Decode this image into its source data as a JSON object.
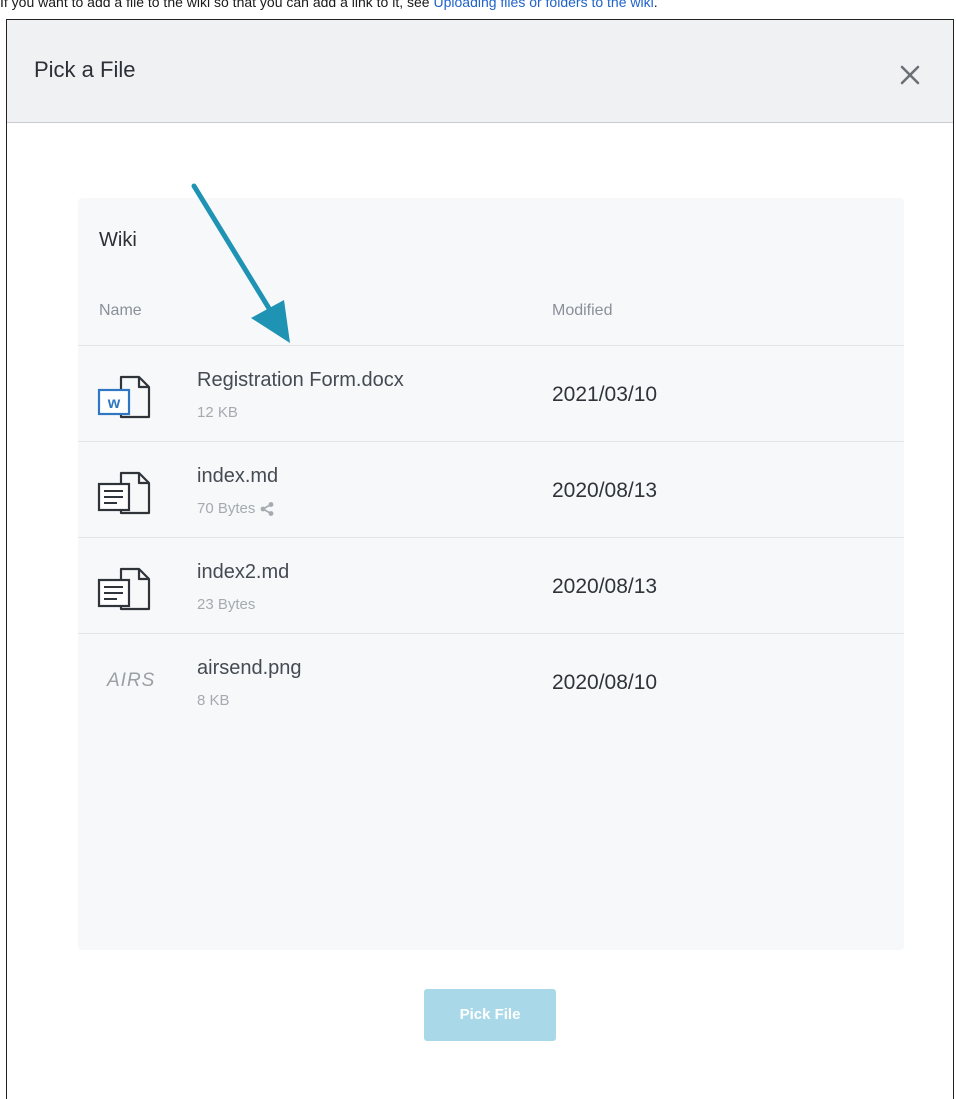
{
  "instruction": {
    "text_before": "If you want to add a file to the wiki so that you can add a link to it, see ",
    "link_text": "Uploading files or folders to the wiki",
    "text_after": "."
  },
  "modal": {
    "title": "Pick a File",
    "close_icon": "close-icon"
  },
  "panel": {
    "title": "Wiki",
    "columns": {
      "name": "Name",
      "modified": "Modified"
    },
    "files": [
      {
        "name": "Registration Form.docx",
        "size": "12 KB",
        "modified": "2021/03/10",
        "icon": "word-document-icon"
      },
      {
        "name": "index.md",
        "size": "70 Bytes",
        "modified": "2020/08/13",
        "icon": "text-document-icon",
        "shared": true
      },
      {
        "name": "index2.md",
        "size": "23 Bytes",
        "modified": "2020/08/13",
        "icon": "text-document-icon"
      },
      {
        "name": "airsend.png",
        "size": "8 KB",
        "modified": "2020/08/10",
        "icon": "image-thumbnail",
        "thumb_text": "AIRS"
      }
    ]
  },
  "footer": {
    "pick_button_label": "Pick File"
  },
  "colors": {
    "accent_arrow": "#1e93b3",
    "pick_button": "#a9d9e8",
    "link": "#1f63c9"
  }
}
